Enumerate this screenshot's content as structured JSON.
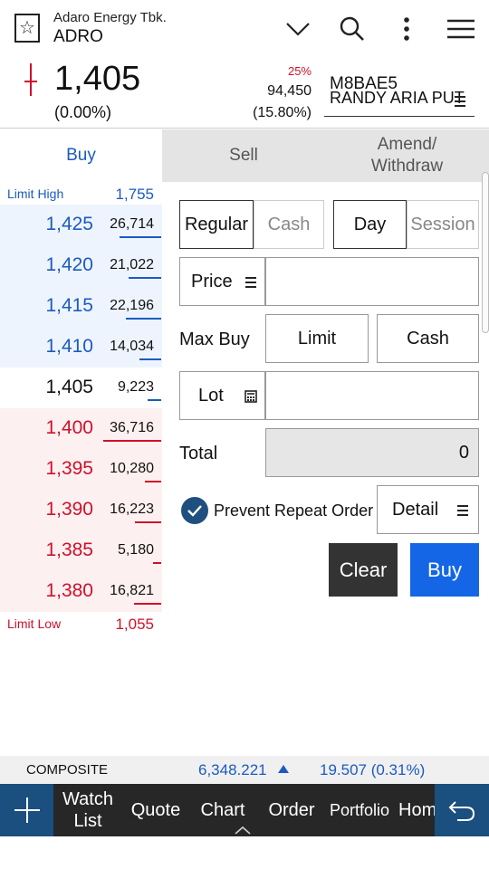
{
  "header": {
    "company_name": "Adaro Energy Tbk.",
    "stock_code": "ADRO"
  },
  "quote": {
    "last_price": "1,405",
    "change": "(0.00%)",
    "limit_pct": "25%",
    "volume": "94,450",
    "volume_pct": "(15.80%)",
    "account_code": "M8BAE5",
    "account_name": "RANDY ARIA PUT"
  },
  "tabs": [
    {
      "label": "Buy",
      "active": true
    },
    {
      "label": "Sell",
      "active": false
    },
    {
      "label": "Amend/\nWithdraw",
      "active": false
    }
  ],
  "orderbook": {
    "limit_high_label": "Limit High",
    "limit_high_value": "1,755",
    "limit_low_label": "Limit Low",
    "limit_low_value": "1,055",
    "rows": [
      {
        "price": "1,425",
        "volume": "26,714",
        "side": "up",
        "bar": 0.42
      },
      {
        "price": "1,420",
        "volume": "21,022",
        "side": "up",
        "bar": 0.33
      },
      {
        "price": "1,415",
        "volume": "22,196",
        "side": "up",
        "bar": 0.35
      },
      {
        "price": "1,410",
        "volume": "14,034",
        "side": "up",
        "bar": 0.22
      },
      {
        "price": "1,405",
        "volume": "9,223",
        "side": "neutral",
        "bar": 0.14
      },
      {
        "price": "1,400",
        "volume": "36,716",
        "side": "down",
        "bar": 0.58
      },
      {
        "price": "1,395",
        "volume": "10,280",
        "side": "down",
        "bar": 0.16
      },
      {
        "price": "1,390",
        "volume": "16,223",
        "side": "down",
        "bar": 0.26
      },
      {
        "price": "1,385",
        "volume": "5,180",
        "side": "down",
        "bar": 0.08
      },
      {
        "price": "1,380",
        "volume": "16,821",
        "side": "down",
        "bar": 0.27
      }
    ]
  },
  "form": {
    "type_regular": "Regular",
    "type_cash": "Cash",
    "expiry_day": "Day",
    "expiry_session": "Session",
    "price_label": "Price",
    "price_value": "",
    "max_buy_label": "Max Buy",
    "max_buy_limit": "Limit",
    "max_buy_cash": "Cash",
    "lot_label": "Lot",
    "lot_value": "",
    "total_label": "Total",
    "total_value": "0",
    "prevent_repeat_label": "Prevent Repeat Order",
    "detail_label": "Detail",
    "clear_label": "Clear",
    "buy_label": "Buy"
  },
  "ticker": {
    "name": "COMPOSITE",
    "index": "6,348.221",
    "change": "19.507 (0.31%)"
  },
  "nav": {
    "items": [
      "Watch\nList",
      "Quote",
      "Chart",
      "Order",
      "Portfolio",
      "Hom"
    ]
  },
  "colors": {
    "up": "#1b5bc0",
    "down": "#d0102a",
    "buy_button": "#1466e6",
    "clear_button": "#333333",
    "nav_accent": "#1a4f7f"
  }
}
